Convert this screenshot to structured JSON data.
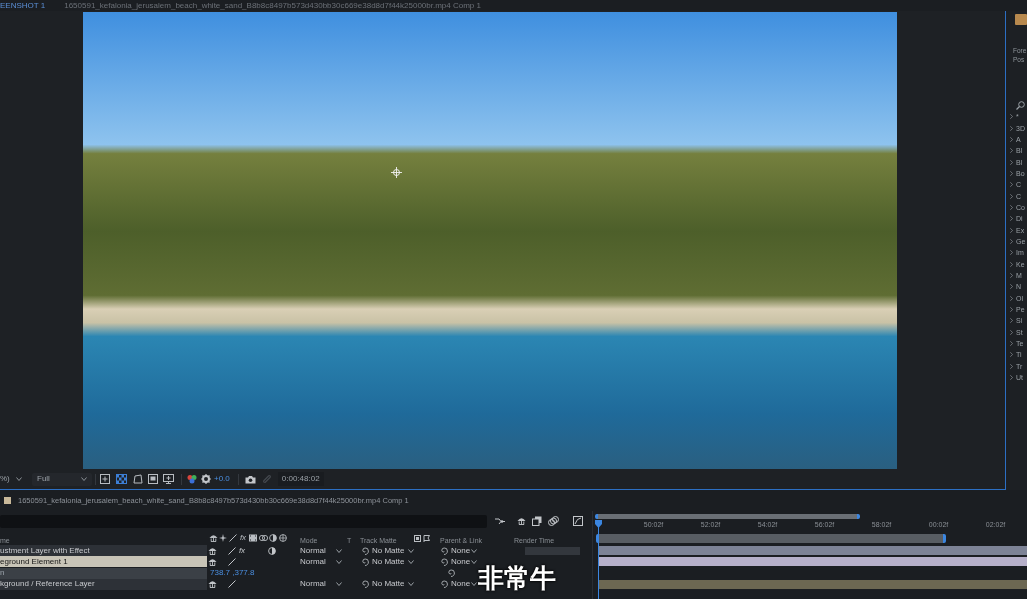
{
  "tabs": [
    {
      "label": "EENSHOT 1",
      "selected": true
    },
    {
      "label": "1650591_kefalonia_jerusalem_beach_white_sand_B8b8c8497b573d430bb30c669e38d8d7f44k25000br.mp4 Comp 1",
      "selected": false
    }
  ],
  "viewer": {
    "toolbar": {
      "zoom": "%)",
      "resolution": "Full",
      "transparency_grid": true,
      "exposure": "+0.0",
      "timecode": "0:00:48:02"
    }
  },
  "right_panel": {
    "labels": [
      "Fore",
      "Pos"
    ],
    "effects": [
      "*",
      "3D",
      "A",
      "Bl",
      "Bl",
      "Bo",
      "C",
      "C",
      "Co",
      "Di",
      "Ex",
      "Ge",
      "Im",
      "Ke",
      "M",
      "N",
      "Ol",
      "Pe",
      "Si",
      "St",
      "Te",
      "Ti",
      "Tr",
      "Ut"
    ]
  },
  "timeline": {
    "comp_name": "1650591_kefalonia_jerusalem_beach_white_sand_B8b8c8497b573d430bb30c669e38d8d7f44k25000br.mp4 Comp 1",
    "ruler": [
      "50:02f",
      "52:02f",
      "54:02f",
      "56:02f",
      "58:02f",
      "00:02f",
      "02:02f"
    ],
    "columns": {
      "name": "me",
      "switch_fx": "fx",
      "mode": "Mode",
      "t": "T",
      "track_matte": "Track Matte",
      "parent": "Parent & Link",
      "render_time": "Render Time"
    },
    "layers": [
      {
        "kind": "layer",
        "name": "ustment Layer with Effect",
        "selected": false,
        "effect_switch": "fx",
        "effects_on": true,
        "adjustment": true,
        "mode": "Normal",
        "track_matte": "No Matte",
        "parent": "None",
        "render_time_bar": true,
        "color": "#7d8396"
      },
      {
        "kind": "layer",
        "name": "eground Element 1",
        "selected": true,
        "adjustment": false,
        "mode": "Normal",
        "track_matte": "No Matte",
        "parent": "None",
        "render_time_bar": false,
        "color": "#b6b0ca"
      },
      {
        "kind": "property",
        "name": "n",
        "value": "738.7 ,377.8"
      },
      {
        "kind": "layer",
        "name": "kground / Reference Layer",
        "selected": false,
        "adjustment": false,
        "mode": "Normal",
        "track_matte": "No Matte",
        "parent": "None",
        "render_time_bar": false,
        "color": "#6c6752"
      }
    ]
  },
  "subtitle": "非常牛"
}
